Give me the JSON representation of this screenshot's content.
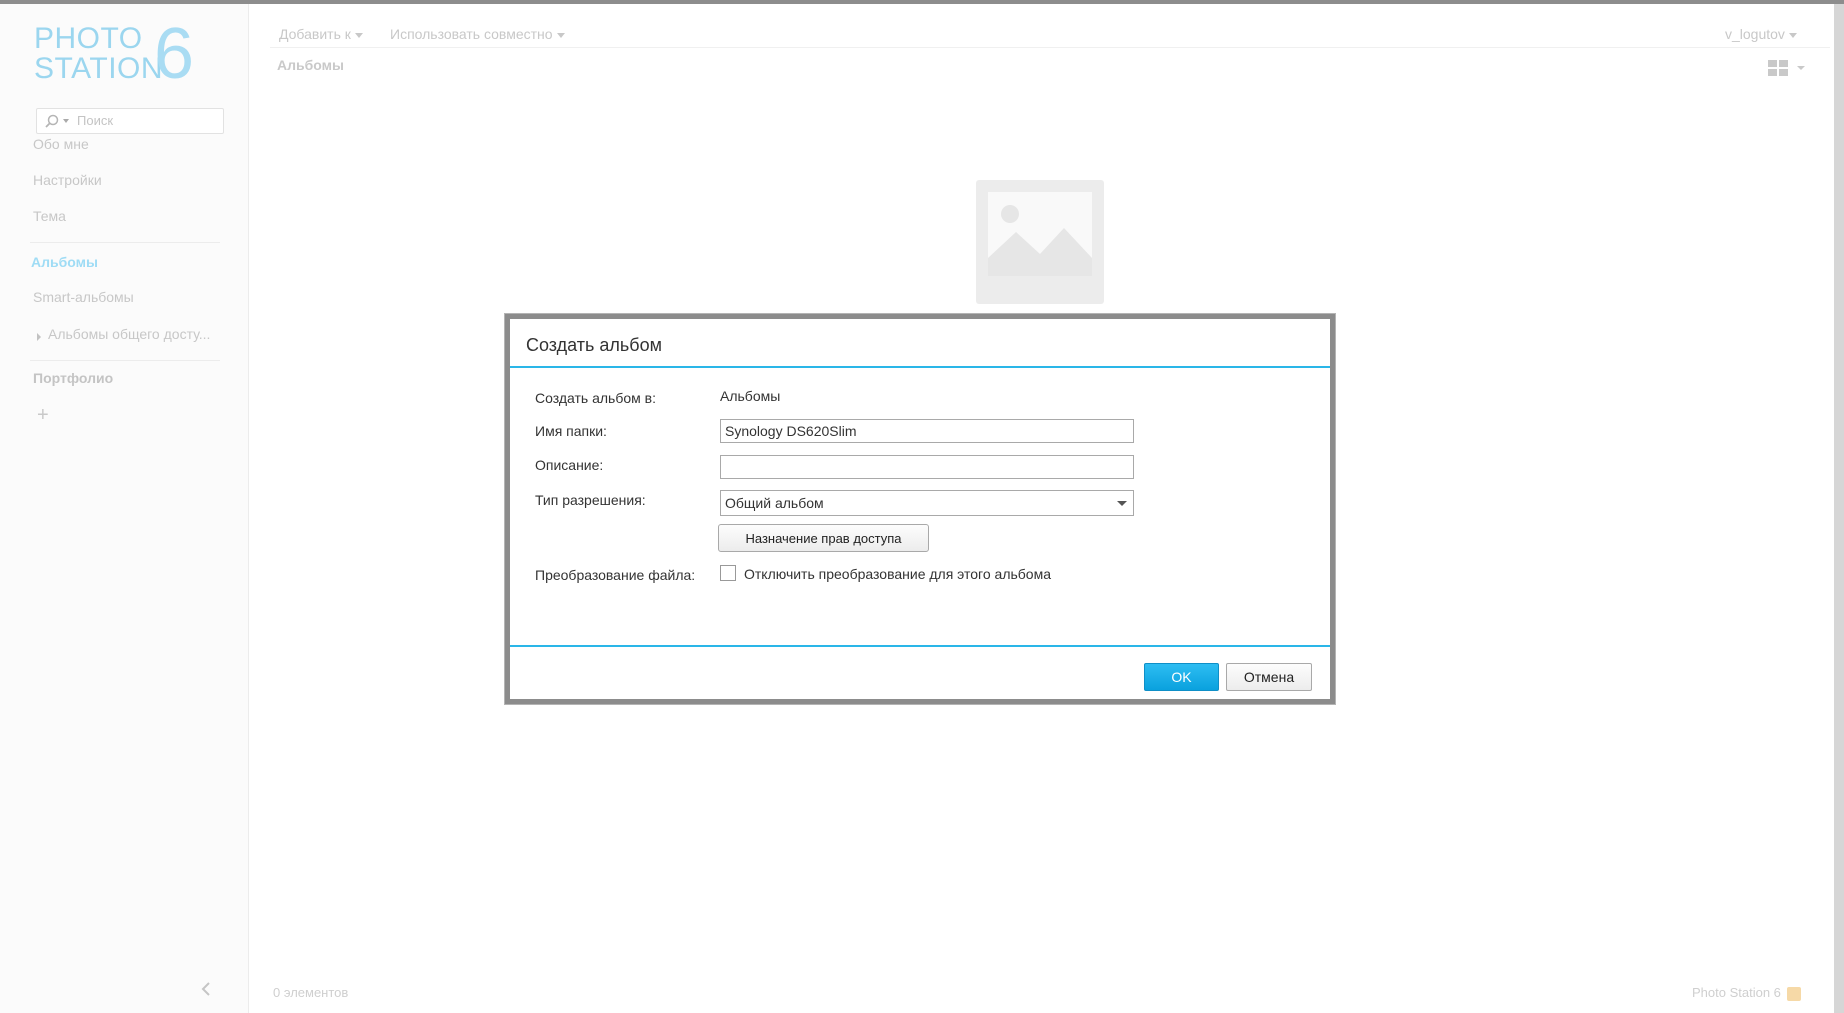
{
  "app": {
    "logo_line1": "PHOTO",
    "logo_line2": "STATION",
    "logo_number": "6"
  },
  "sidebar": {
    "search_placeholder": "Поиск",
    "items": [
      {
        "label": "Обо мне"
      },
      {
        "label": "Настройки"
      },
      {
        "label": "Тема"
      },
      {
        "label": "Альбомы"
      },
      {
        "label": "Smart-альбомы"
      },
      {
        "label": "Альбомы общего досту..."
      },
      {
        "label": "Портфолио"
      }
    ],
    "add_symbol": "+"
  },
  "toolbar": {
    "add_to": "Добавить к",
    "share": "Использовать совместно",
    "user": "v_logutov"
  },
  "breadcrumb": "Альбомы",
  "footer": {
    "items_count": "0 элементов",
    "app_name": "Photo Station 6"
  },
  "dialog": {
    "title": "Создать альбом",
    "create_in_label": "Создать альбом в:",
    "create_in_value": "Альбомы",
    "folder_name_label": "Имя папки:",
    "folder_name_value": "Synology DS620Slim",
    "description_label": "Описание:",
    "description_value": "",
    "permission_type_label": "Тип разрешения:",
    "permission_type_value": "Общий альбом",
    "assign_permissions_button": "Назначение прав доступа",
    "file_conversion_label": "Преобразование файла:",
    "disable_conversion_label": "Отключить преобразование для этого альбома",
    "disable_conversion_checked": false,
    "ok_button": "OK",
    "cancel_button": "Отмена"
  },
  "colors": {
    "accent": "#2ab6e8",
    "ok_button": "#0aa1de"
  }
}
